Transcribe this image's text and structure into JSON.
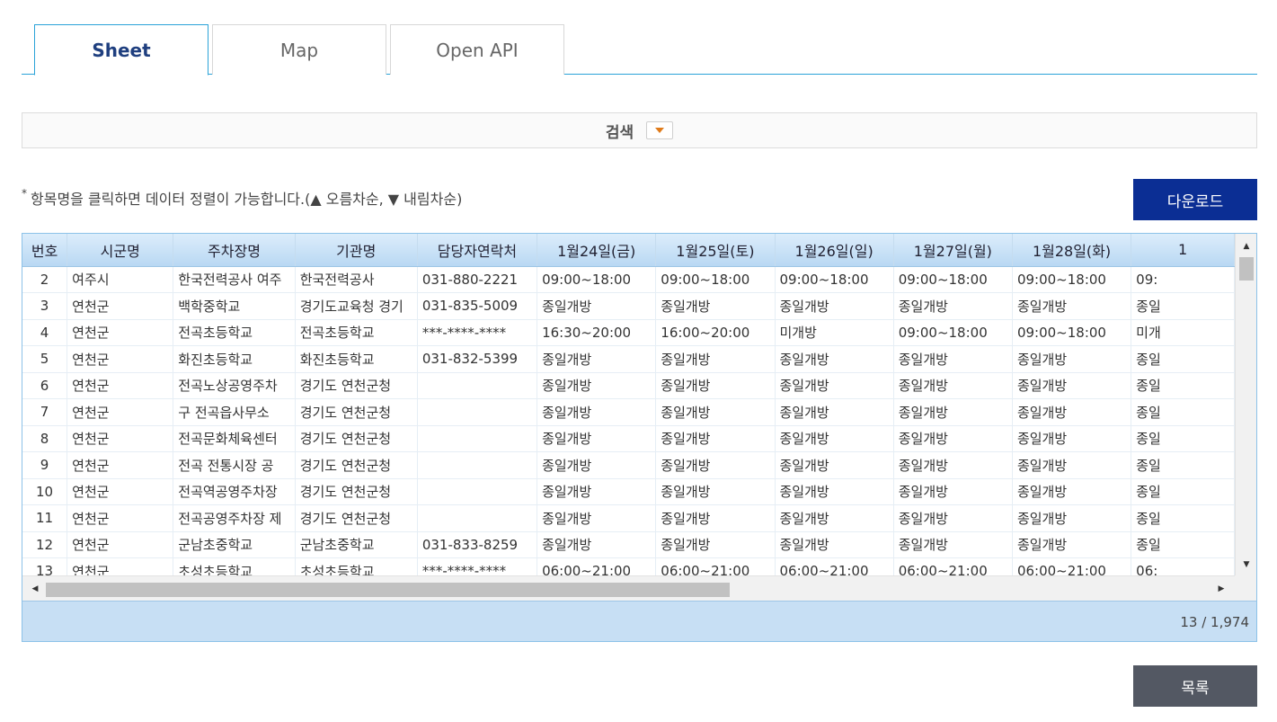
{
  "tabs": [
    {
      "label": "Sheet",
      "active": true
    },
    {
      "label": "Map",
      "active": false
    },
    {
      "label": "Open API",
      "active": false
    }
  ],
  "search": {
    "label": "검색",
    "toggle_icon": "chevron-down-icon"
  },
  "notice": {
    "star": "*",
    "text": "항목명을 클릭하면 데이터 정렬이 가능합니다.(▲ 오름차순, ▼ 내림차순)"
  },
  "download_button": "다운로드",
  "list_button": "목록",
  "colors": {
    "accent": "#2ba3d8",
    "download": "#0b2e94",
    "list": "#535863",
    "header": "#b9d8f3",
    "footer": "#c7dff4"
  },
  "table": {
    "headers": [
      "번호",
      "시군명",
      "주차장명",
      "기관명",
      "담당자연락처",
      "1월24일(금)",
      "1월25일(토)",
      "1월26일(일)",
      "1월27일(월)",
      "1월28일(화)",
      "1"
    ],
    "rows": [
      [
        "2",
        "여주시",
        "한국전력공사 여주",
        "한국전력공사",
        "031-880-2221",
        "09:00~18:00",
        "09:00~18:00",
        "09:00~18:00",
        "09:00~18:00",
        "09:00~18:00",
        "09:"
      ],
      [
        "3",
        "연천군",
        "백학중학교",
        "경기도교육청 경기",
        "031-835-5009",
        "종일개방",
        "종일개방",
        "종일개방",
        "종일개방",
        "종일개방",
        "종일"
      ],
      [
        "4",
        "연천군",
        "전곡초등학교",
        "전곡초등학교",
        "***-****-****",
        "16:30~20:00",
        "16:00~20:00",
        "미개방",
        "09:00~18:00",
        "09:00~18:00",
        "미개"
      ],
      [
        "5",
        "연천군",
        "화진초등학교",
        "화진초등학교",
        "031-832-5399",
        "종일개방",
        "종일개방",
        "종일개방",
        "종일개방",
        "종일개방",
        "종일"
      ],
      [
        "6",
        "연천군",
        "전곡노상공영주차",
        "경기도 연천군청",
        "",
        "종일개방",
        "종일개방",
        "종일개방",
        "종일개방",
        "종일개방",
        "종일"
      ],
      [
        "7",
        "연천군",
        "구 전곡읍사무소",
        "경기도 연천군청",
        "",
        "종일개방",
        "종일개방",
        "종일개방",
        "종일개방",
        "종일개방",
        "종일"
      ],
      [
        "8",
        "연천군",
        "전곡문화체육센터",
        "경기도 연천군청",
        "",
        "종일개방",
        "종일개방",
        "종일개방",
        "종일개방",
        "종일개방",
        "종일"
      ],
      [
        "9",
        "연천군",
        "전곡 전통시장 공",
        "경기도 연천군청",
        "",
        "종일개방",
        "종일개방",
        "종일개방",
        "종일개방",
        "종일개방",
        "종일"
      ],
      [
        "10",
        "연천군",
        "전곡역공영주차장",
        "경기도 연천군청",
        "",
        "종일개방",
        "종일개방",
        "종일개방",
        "종일개방",
        "종일개방",
        "종일"
      ],
      [
        "11",
        "연천군",
        "전곡공영주차장 제",
        "경기도 연천군청",
        "",
        "종일개방",
        "종일개방",
        "종일개방",
        "종일개방",
        "종일개방",
        "종일"
      ],
      [
        "12",
        "연천군",
        "군남초중학교",
        "군남초중학교",
        "031-833-8259",
        "종일개방",
        "종일개방",
        "종일개방",
        "종일개방",
        "종일개방",
        "종일"
      ],
      [
        "13",
        "연천군",
        "초성초등학교",
        "초성초등학교",
        "***-****-****",
        "06:00~21:00",
        "06:00~21:00",
        "06:00~21:00",
        "06:00~21:00",
        "06:00~21:00",
        "06:"
      ]
    ]
  },
  "pagination": {
    "count": "13 / 1,974"
  }
}
